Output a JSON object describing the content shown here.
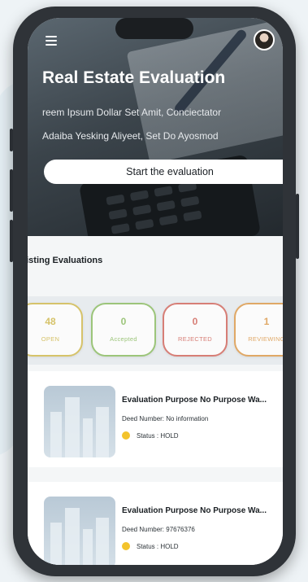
{
  "hero": {
    "title": "Real Estate Evaluation",
    "subtitle_line1": "reem Ipsum Dollar Set Amit, Conciectator",
    "subtitle_line2": "Adaiba Yesking Aliyeet, Set Do Ayosmod",
    "button_label": "Start the evaluation"
  },
  "section": {
    "title": "xisting Evaluations"
  },
  "statuses": [
    {
      "count": "48",
      "label": "OPEN",
      "color": "#d6c36a"
    },
    {
      "count": "0",
      "label": "Accepted",
      "color": "#9cc57a"
    },
    {
      "count": "0",
      "label": "REJECTED",
      "color": "#d77e76"
    },
    {
      "count": "1",
      "label": "REVIEWING",
      "color": "#e0a866"
    }
  ],
  "evaluations": [
    {
      "title": "Evaluation Purpose No Purpose Wa...",
      "deed": "Deed Number: No information",
      "status": "Status : HOLD",
      "status_color": "#f3c32c"
    },
    {
      "title": "Evaluation Purpose No Purpose Wa...",
      "deed": "Deed Number: 97676376",
      "status": "Status : HOLD",
      "status_color": "#f3c32c"
    }
  ],
  "icons": {
    "menu": "menu-icon",
    "avatar": "avatar",
    "status_dot": "status-dot-icon",
    "building": "building-thumbnail"
  },
  "colors": {
    "phone_frame": "#2f3338",
    "background": "#eef3f6",
    "hold": "#f3c32c"
  }
}
